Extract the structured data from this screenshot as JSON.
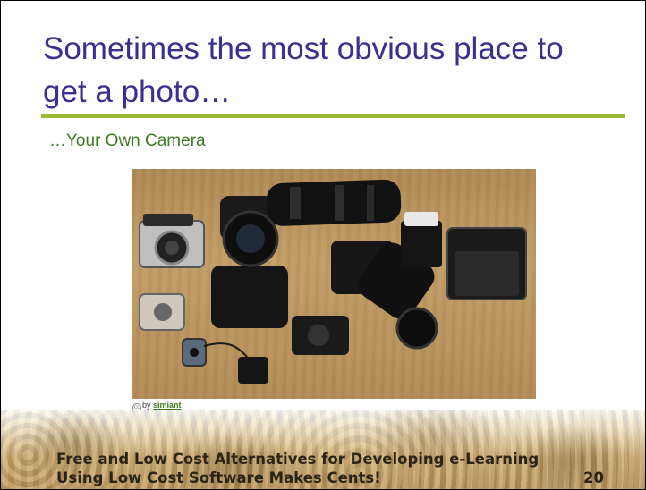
{
  "slide": {
    "title": "Sometimes the most obvious place to get a photo…",
    "subtitle": "…Your Own Camera",
    "photo_credit": {
      "prefix": "by",
      "author": "simiant"
    },
    "footer": {
      "line1": "Free and Low Cost Alternatives for Developing e-Learning",
      "line2": "Using Low Cost Software Makes Cents!",
      "page_number": "20"
    }
  },
  "colors": {
    "title": "#3b2f8f",
    "rule": "#99bb33",
    "subtitle": "#3d7a22",
    "photo_table": "#b08a54"
  }
}
